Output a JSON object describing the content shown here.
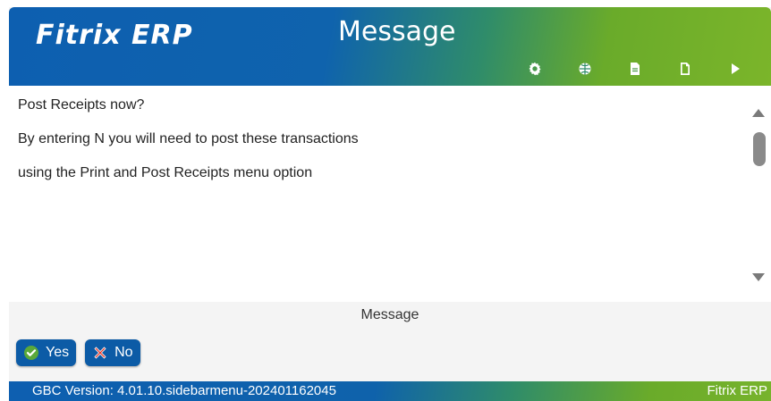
{
  "header": {
    "logo_text": "Fitrix ERP",
    "title": "Message",
    "toolbar": [
      {
        "icon": "gear-icon"
      },
      {
        "icon": "globe-icon"
      },
      {
        "icon": "document-filled-icon"
      },
      {
        "icon": "document-outline-icon"
      },
      {
        "icon": "play-icon"
      }
    ]
  },
  "message": {
    "lines": [
      "Post Receipts now?",
      "By entering N you will need to post these transactions",
      "using the Print and Post Receipts menu option"
    ]
  },
  "footer": {
    "label": "Message",
    "yes_label": "Yes",
    "no_label": "No"
  },
  "statusbar": {
    "version": "GBC Version: 4.01.10.sidebarmenu-202401162045",
    "brand": "Fitrix ERP"
  },
  "colors": {
    "primary_blue": "#0c5ba6",
    "accent_green": "#7bb52a",
    "logo_orange": "#f5a623"
  }
}
